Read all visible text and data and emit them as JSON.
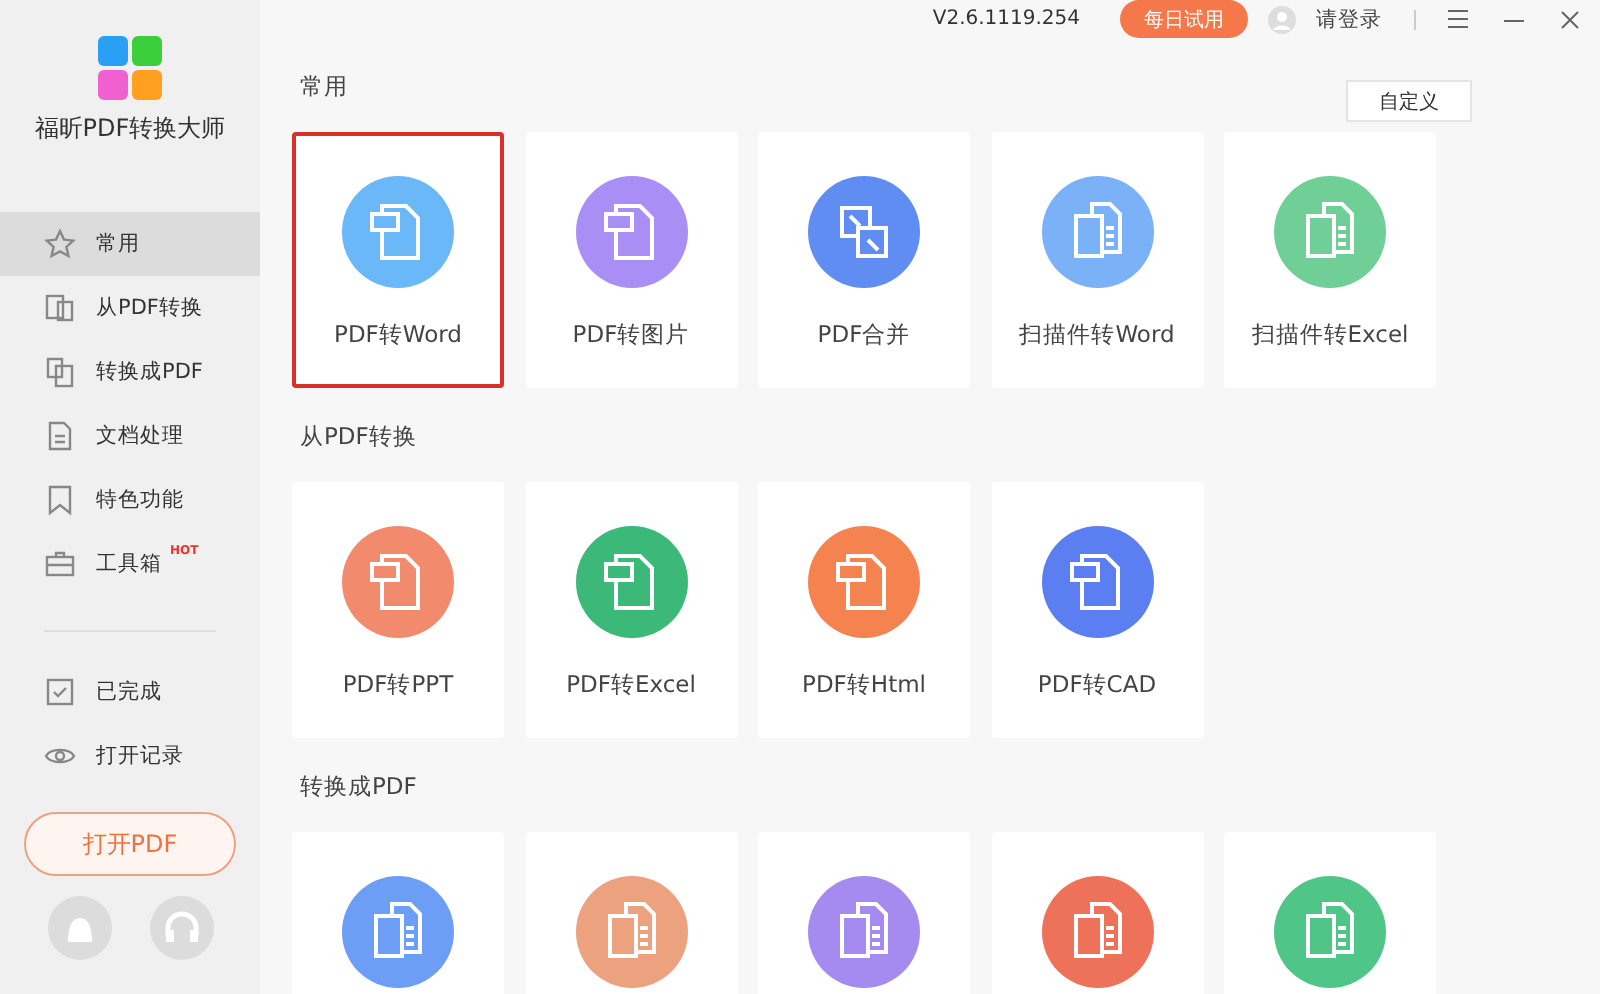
{
  "app": {
    "name": "福昕PDF转换大师"
  },
  "sidebar": {
    "items": [
      {
        "label": "常用",
        "kind": "star",
        "selected": true
      },
      {
        "label": "从PDF转换",
        "kind": "from",
        "selected": false
      },
      {
        "label": "转换成PDF",
        "kind": "to",
        "selected": false
      },
      {
        "label": "文档处理",
        "kind": "doc",
        "selected": false
      },
      {
        "label": "特色功能",
        "kind": "bookmark",
        "selected": false
      },
      {
        "label": "工具箱",
        "kind": "toolbox",
        "selected": false,
        "badge": "HOT"
      }
    ],
    "bottom_items": [
      {
        "label": "已完成",
        "kind": "check",
        "selected": false
      },
      {
        "label": "打开记录",
        "kind": "eye",
        "selected": false
      }
    ],
    "open_button": "打开PDF"
  },
  "topbar": {
    "version": "V2.6.1119.254",
    "trial_button": "每日试用",
    "login": "请登录"
  },
  "customize_button": "自定义",
  "sections": [
    {
      "title": "常用",
      "cards": [
        {
          "label": "PDF转Word",
          "kind": "from-pdf",
          "color": "#6ab8f7",
          "selected": true
        },
        {
          "label": "PDF转图片",
          "kind": "from-pdf",
          "color": "#a98ef5",
          "selected": false
        },
        {
          "label": "PDF合并",
          "kind": "merge",
          "color": "#5f8df2",
          "selected": false
        },
        {
          "label": "扫描件转Word",
          "kind": "to-pdf",
          "color": "#7bb1f7",
          "selected": false
        },
        {
          "label": "扫描件转Excel",
          "kind": "to-pdf",
          "color": "#6fcf97",
          "selected": false
        }
      ]
    },
    {
      "title": "从PDF转换",
      "cards": [
        {
          "label": "PDF转PPT",
          "kind": "from-pdf",
          "color": "#f28b6e",
          "selected": false
        },
        {
          "label": "PDF转Excel",
          "kind": "from-pdf",
          "color": "#3cb878",
          "selected": false
        },
        {
          "label": "PDF转Html",
          "kind": "from-pdf",
          "color": "#f5834f",
          "selected": false
        },
        {
          "label": "PDF转CAD",
          "kind": "from-pdf",
          "color": "#5b7ff0",
          "selected": false
        }
      ]
    },
    {
      "title": "转换成PDF",
      "cards": [
        {
          "kind": "to-pdf",
          "color": "#6d9ef5",
          "selected": false
        },
        {
          "kind": "to-pdf",
          "color": "#eda27f",
          "selected": false
        },
        {
          "kind": "to-pdf",
          "color": "#a58bf0",
          "selected": false
        },
        {
          "kind": "to-pdf",
          "color": "#ee7259",
          "selected": false
        },
        {
          "kind": "to-pdf",
          "color": "#4fc688",
          "selected": false
        }
      ]
    }
  ]
}
